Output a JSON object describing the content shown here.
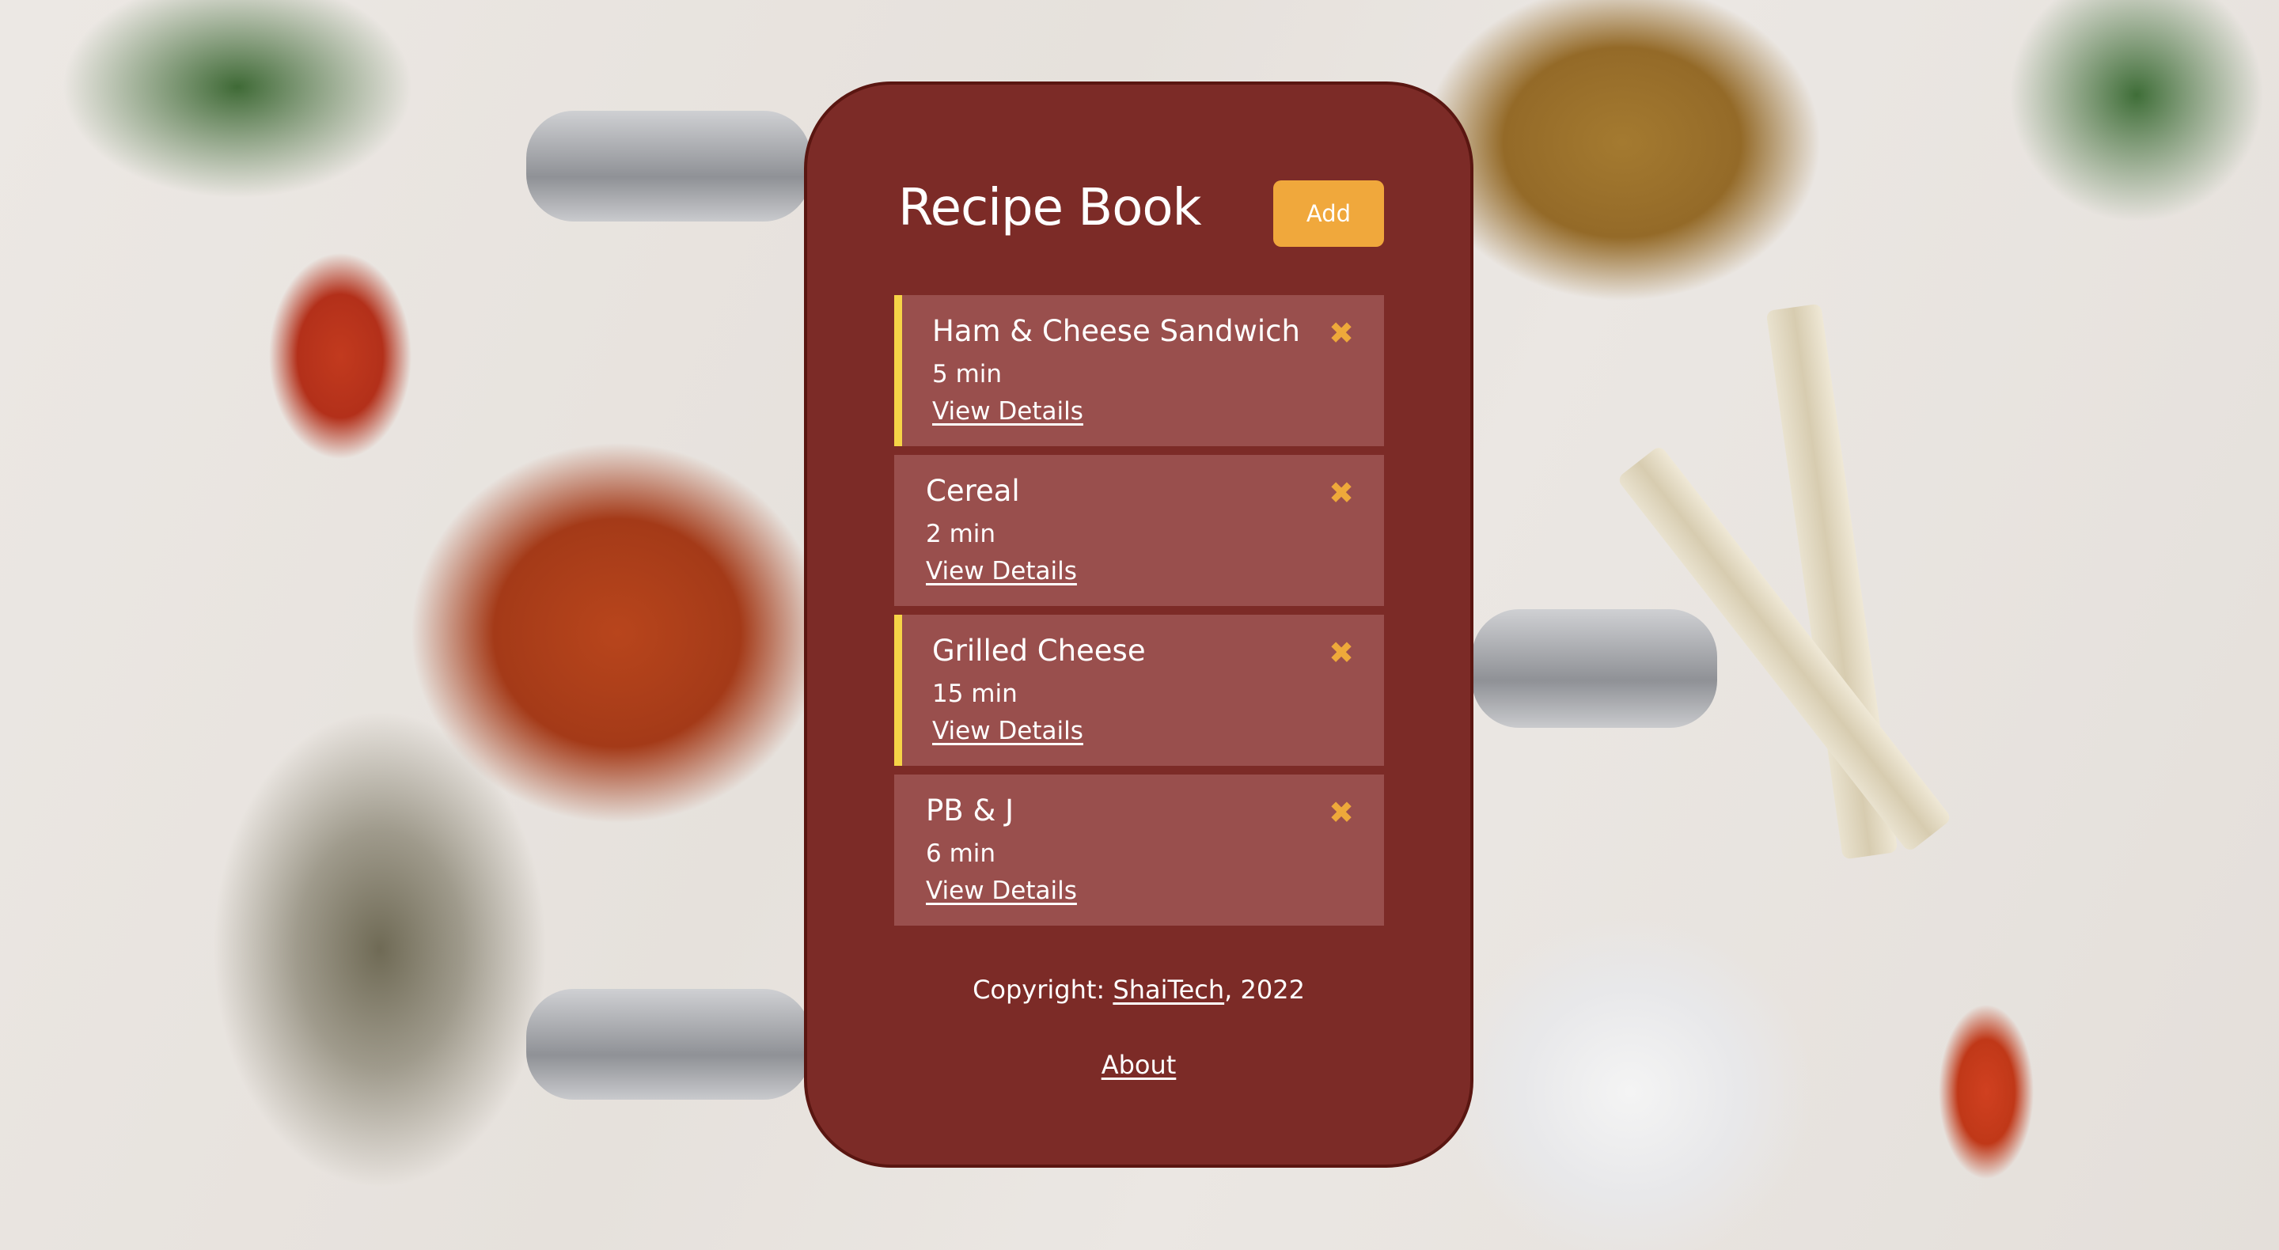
{
  "header": {
    "title": "Recipe Book",
    "add_label": "Add"
  },
  "recipes": [
    {
      "name": "Ham & Cheese Sandwich",
      "time": "5 min",
      "link": "View Details",
      "highlighted": true
    },
    {
      "name": "Cereal",
      "time": "2 min",
      "link": "View Details",
      "highlighted": false
    },
    {
      "name": "Grilled Cheese",
      "time": "15 min",
      "link": "View Details",
      "highlighted": true
    },
    {
      "name": "PB & J",
      "time": "6 min",
      "link": "View Details",
      "highlighted": false
    }
  ],
  "icons": {
    "delete": "✖"
  },
  "footer": {
    "copyright_prefix": "Copyright:",
    "company": "ShaiTech",
    "year_suffix": ", 2022",
    "about": "About"
  },
  "colors": {
    "card": "#7c2b27",
    "accent": "#f0a83c",
    "highlight_border": "#f6d447",
    "delete_icon": "#eea93a"
  }
}
